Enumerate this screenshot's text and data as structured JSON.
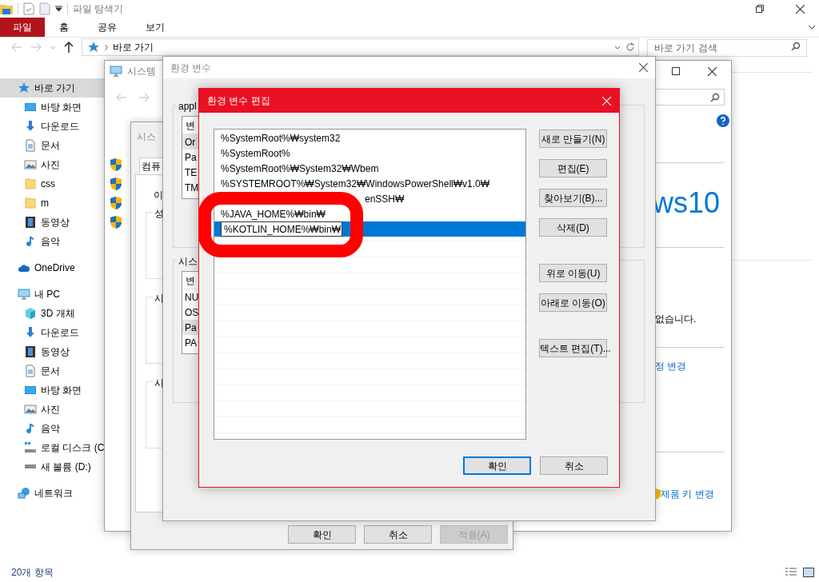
{
  "explorer": {
    "title": "파일 탐색기",
    "ribbon_tabs": [
      {
        "label": "파일",
        "selected": true
      },
      {
        "label": "홈",
        "selected": false
      },
      {
        "label": "공유",
        "selected": false
      },
      {
        "label": "보기",
        "selected": false
      }
    ],
    "address": "바로 가기",
    "search": {
      "placeholder": "바로 가기 검색"
    },
    "sidebar": [
      {
        "label": "바로 가기",
        "kind": "quick",
        "selected": true,
        "children": [
          {
            "label": "바탕 화면",
            "kind": "desktop",
            "selected": false
          },
          {
            "label": "다운로드",
            "kind": "download",
            "selected": false
          },
          {
            "label": "문서",
            "kind": "document",
            "selected": false
          },
          {
            "label": "사진",
            "kind": "picture",
            "selected": false
          },
          {
            "label": "css",
            "kind": "folder",
            "selected": false
          },
          {
            "label": "m",
            "kind": "folder",
            "selected": false
          },
          {
            "label": "동영상",
            "kind": "video",
            "selected": false
          },
          {
            "label": "음악",
            "kind": "music",
            "selected": false
          }
        ]
      },
      {
        "label": "OneDrive",
        "kind": "cloud",
        "selected": false
      },
      {
        "label": "내 PC",
        "kind": "pc",
        "selected": false,
        "children": [
          {
            "label": "3D 개체",
            "kind": "cube",
            "selected": false
          },
          {
            "label": "다운로드",
            "kind": "download",
            "selected": false
          },
          {
            "label": "동영상",
            "kind": "video",
            "selected": false
          },
          {
            "label": "문서",
            "kind": "document",
            "selected": false
          },
          {
            "label": "바탕 화면",
            "kind": "desktop",
            "selected": false
          },
          {
            "label": "사진",
            "kind": "picture",
            "selected": false
          },
          {
            "label": "음악",
            "kind": "music",
            "selected": false
          },
          {
            "label": "로컬 디스크 (C",
            "kind": "disk",
            "selected": false
          },
          {
            "label": "새 볼륨 (D:)",
            "kind": "drive",
            "selected": false
          }
        ]
      },
      {
        "label": "네트워크",
        "kind": "network",
        "selected": false
      }
    ],
    "status_bar": "20개 항목"
  },
  "system_window": {
    "title": "시스템",
    "brand": "ws10",
    "note": "없습니다.",
    "links": [
      "정 변경",
      "제품 키 변경"
    ]
  },
  "system_properties": {
    "title": "시스",
    "tab": "컴퓨",
    "label": "이",
    "groups": [
      "성",
      "시",
      "시"
    ],
    "buttons": [
      {
        "label": "확인",
        "disabled": false
      },
      {
        "label": "취소",
        "disabled": false
      },
      {
        "label": "적용(A)",
        "disabled": true
      }
    ]
  },
  "env_window": {
    "title": "환경 변수",
    "groups": [
      {
        "label": "appl",
        "header": "변",
        "rows": [
          {
            "text": "Or",
            "selected": true
          },
          {
            "text": "Pa",
            "selected": false
          },
          {
            "text": "TE",
            "selected": false
          },
          {
            "text": "TM",
            "selected": false
          }
        ]
      },
      {
        "label": "시스",
        "header": "변",
        "rows": [
          {
            "text": "NU",
            "selected": false
          },
          {
            "text": "OS",
            "selected": false
          },
          {
            "text": "Pa",
            "selected": true
          },
          {
            "text": "PA",
            "selected": false
          }
        ]
      }
    ]
  },
  "edit_dialog": {
    "title": "환경 변수 편집",
    "entries": [
      {
        "text": "%SystemRoot%₩system32",
        "kind": "normal",
        "selected": false,
        "editing": false
      },
      {
        "text": "%SystemRoot%",
        "kind": "normal",
        "selected": false,
        "editing": false
      },
      {
        "text": "%SystemRoot%₩System32₩Wbem",
        "kind": "normal",
        "selected": false,
        "editing": false
      },
      {
        "text": "%SYSTEMROOT%₩System32₩WindowsPowerShell₩v1.0₩",
        "kind": "normal",
        "selected": false,
        "editing": false
      },
      {
        "text": "enSSH₩",
        "kind": "partial",
        "selected": false,
        "editing": false
      },
      {
        "text": "%JAVA_HOME%₩bin₩",
        "kind": "normal",
        "selected": false,
        "editing": false
      },
      {
        "text": "%KOTLIN_HOME%₩bin₩",
        "kind": "normal",
        "selected": true,
        "editing": true
      }
    ],
    "side_button_groups": [
      {
        "buttons": [
          "새로 만들기(N)",
          "편집(E)",
          "찾아보기(B)...",
          "삭제(D)"
        ]
      },
      {
        "buttons": [
          "위로 이동(U)",
          "아래로 이동(O)"
        ]
      },
      {
        "buttons": [
          "텍스트 편집(T)..."
        ]
      }
    ],
    "bottom_buttons": [
      {
        "label": "확인",
        "default": true
      },
      {
        "label": "취소",
        "default": false
      }
    ]
  }
}
